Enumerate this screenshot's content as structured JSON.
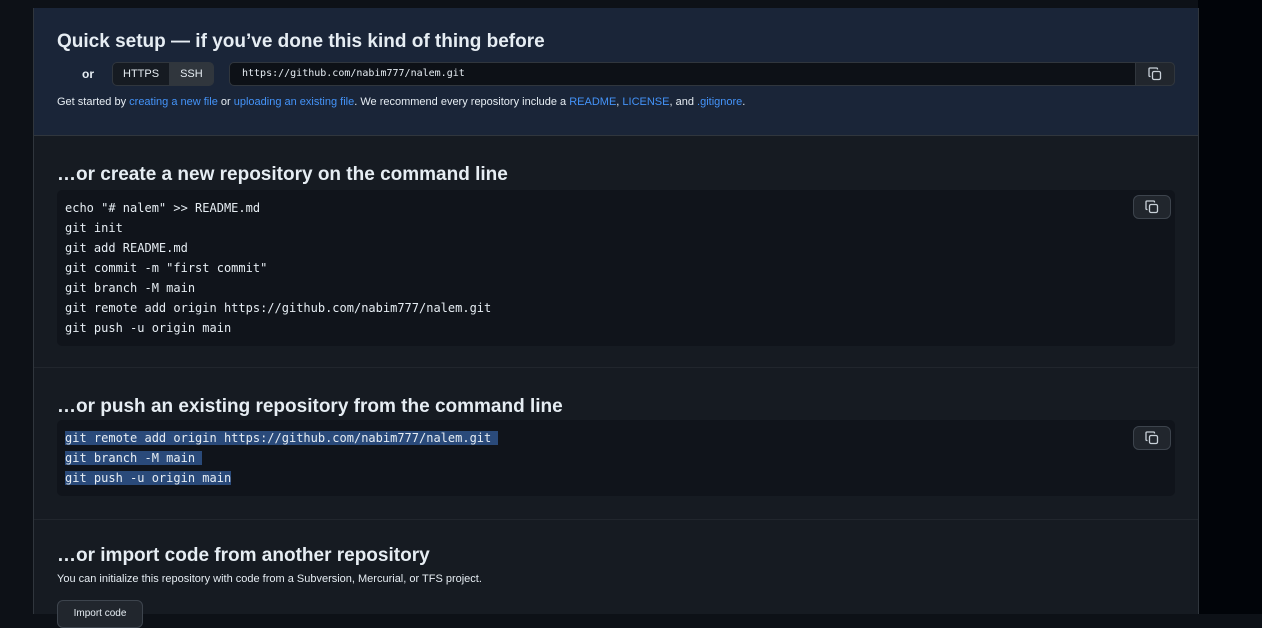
{
  "quick_setup": {
    "title": "Quick setup — if you’ve done this kind of thing before",
    "or_label": "or",
    "protocols": [
      "HTTPS",
      "SSH"
    ],
    "selected_protocol": "SSH",
    "url": "https://github.com/nabim777/nalem.git",
    "desc_prefix": "Get started by ",
    "link_new_file": "creating a new file",
    "desc_or": " or ",
    "link_upload": "uploading an existing file",
    "desc_mid": ". We recommend every repository include a ",
    "link_readme": "README",
    "desc_comma": ", ",
    "link_license": "LICENSE",
    "desc_and": ", and ",
    "link_gitignore": ".gitignore",
    "desc_end": "."
  },
  "new_repo": {
    "title": "…or create a new repository on the command line",
    "lines": [
      "echo \"# nalem\" >> README.md",
      "git init",
      "git add README.md",
      "git commit -m \"first commit\"",
      "git branch -M main",
      "git remote add origin https://github.com/nabim777/nalem.git",
      "git push -u origin main"
    ]
  },
  "push_existing": {
    "title": "…or push an existing repository from the command line",
    "lines": [
      "git remote add origin https://github.com/nabim777/nalem.git ",
      "git branch -M main ",
      "git push -u origin main"
    ]
  },
  "import": {
    "title": "…or import code from another repository",
    "desc": "You can initialize this repository with code from a Subversion, Mercurial, or TFS project.",
    "button_label": "Import code"
  },
  "icons": {
    "copy": "copy-icon"
  },
  "colors": {
    "link": "#4493f8",
    "highlight": "#2a4a7a"
  }
}
